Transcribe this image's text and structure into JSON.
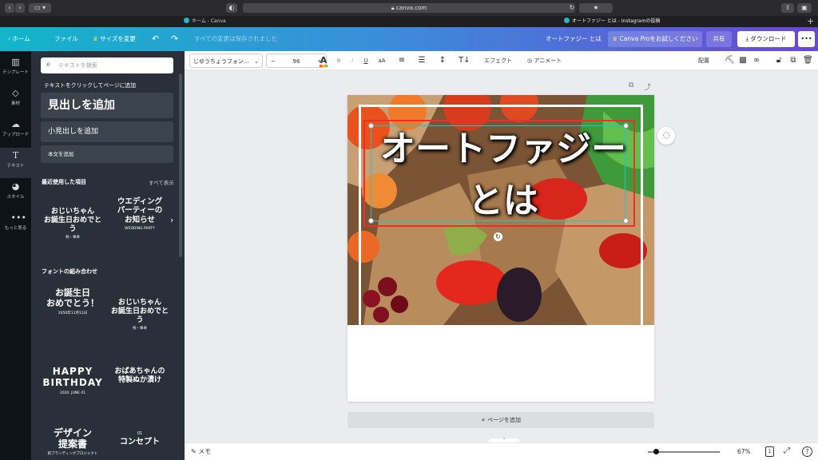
{
  "browser": {
    "url": "canva.com",
    "tabs": [
      {
        "label": "ホーム - Canva"
      },
      {
        "label": "オートファジー とは - Instagramの投稿"
      }
    ],
    "new_tab_label": "+"
  },
  "header": {
    "home_label": "ホーム",
    "file_label": "ファイル",
    "resize_label": "サイズを変更",
    "save_status": "すべての変更は保存されました",
    "doc_title": "オートファジー とは",
    "try_pro_label": "Canva Proをお試しください",
    "share_label": "共有",
    "download_label": "ダウンロード",
    "more_label": "•••"
  },
  "rail": {
    "items": [
      {
        "label": "テンプレート",
        "icon": "template-icon"
      },
      {
        "label": "素材",
        "icon": "elements-icon"
      },
      {
        "label": "アップロード",
        "icon": "upload-icon"
      },
      {
        "label": "テキスト",
        "icon": "text-icon"
      },
      {
        "label": "スタイル",
        "icon": "palette-icon"
      },
      {
        "label": "もっと見る",
        "icon": "more-icon"
      }
    ]
  },
  "panel": {
    "search_placeholder": "テキストを検索",
    "click_hint": "テキストをクリックしてページに追加",
    "add_heading": "見出しを追加",
    "add_subheading": "小見出しを追加",
    "add_body": "本文を追加",
    "recent_title": "最近使用した項目",
    "see_all": "すべて表示",
    "recent_items": [
      {
        "text": "おじいちゃん\nお誕生日おめでとう",
        "sub": "祝・傘寿"
      },
      {
        "text": "ウエディング\nパーティーの\nお知らせ",
        "sub": "WEDDING PARTY"
      }
    ],
    "combos_title": "フォントの組み合わせ",
    "combos": [
      {
        "text": "お誕生日\nおめでとう！",
        "sub": "2050年11月11日"
      },
      {
        "text": "おじいちゃん\nお誕生日おめでとう",
        "sub": "祝・傘寿"
      },
      {
        "text": "HAPPY\nBIRTHDAY",
        "sub": "2020. JUNE 01"
      },
      {
        "text": "おばあちゃんの\n特製ぬか漬け",
        "sub": ""
      },
      {
        "text": "デザイン\n提案書",
        "sub": "新ブランディングプロジェクト"
      },
      {
        "text": "コンセプト",
        "sub": "01"
      }
    ]
  },
  "toolbar": {
    "font_name": "じゆうちょうフォン...",
    "font_size": "96",
    "effects_label": "エフェクト",
    "animate_label": "アニメート",
    "position_label": "配置"
  },
  "canvas": {
    "heading_line1": "オートファジー",
    "heading_line2": "とは",
    "add_page_label": "+ ページを追加"
  },
  "footer": {
    "notes_label": "メモ",
    "zoom": "67%",
    "page_number": "1",
    "help_label": "?"
  },
  "colors": {
    "header_start": "#11b6c9",
    "header_end": "#6a47d8",
    "selection": "#25c0d3",
    "frame_red": "#e6322b"
  }
}
